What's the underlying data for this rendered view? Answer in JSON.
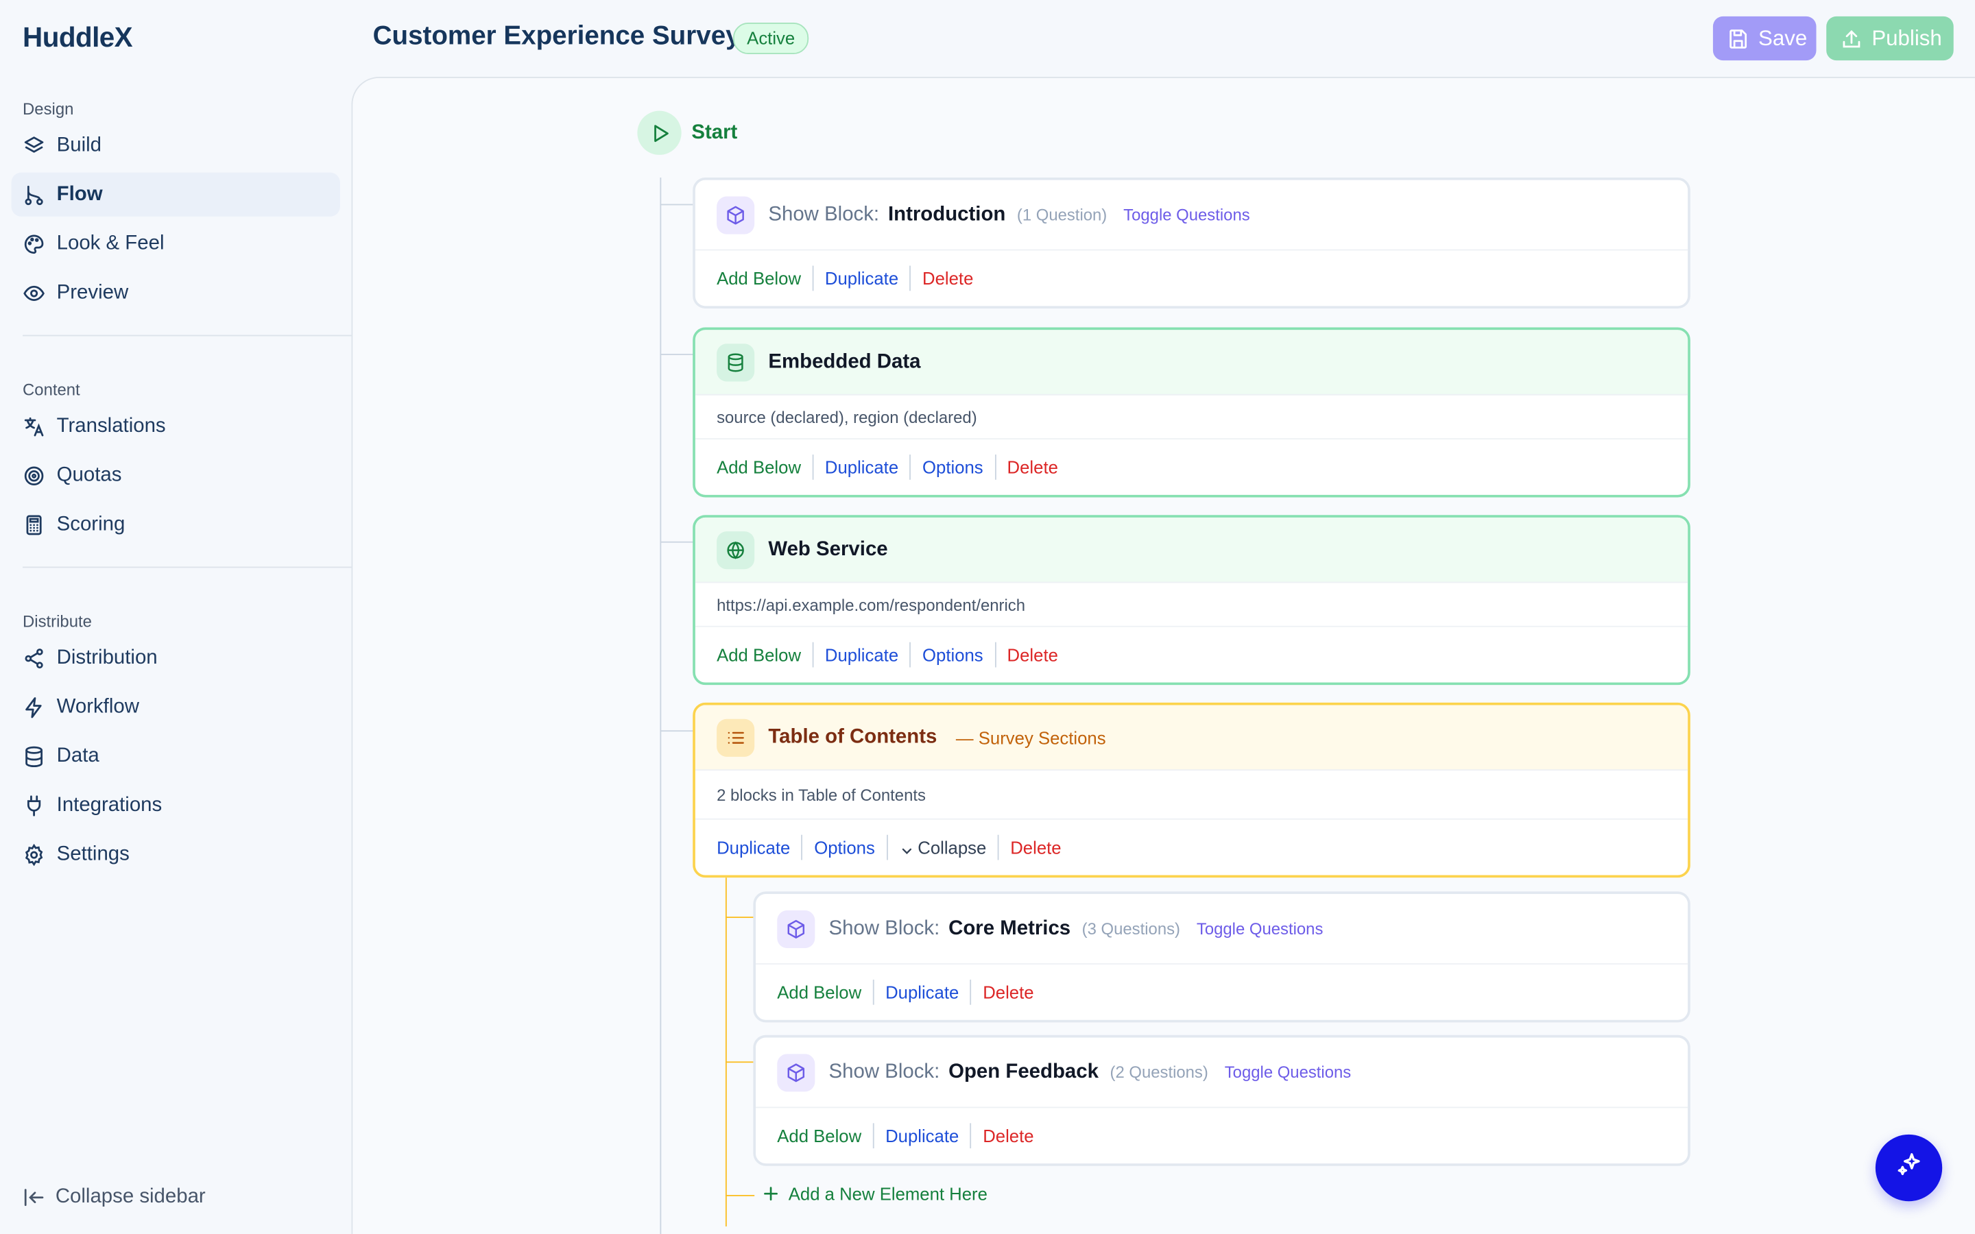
{
  "app": {
    "logo": "HuddleX"
  },
  "header": {
    "title": "Customer Experience Survey",
    "status": "Active",
    "save_label": "Save",
    "publish_label": "Publish"
  },
  "sidebar": {
    "sections": [
      {
        "heading": "Design",
        "items": [
          {
            "label": "Build",
            "icon": "layers-icon"
          },
          {
            "label": "Flow",
            "icon": "flow-icon",
            "active": true
          },
          {
            "label": "Look & Feel",
            "icon": "palette-icon"
          },
          {
            "label": "Preview",
            "icon": "eye-icon"
          }
        ]
      },
      {
        "heading": "Content",
        "items": [
          {
            "label": "Translations",
            "icon": "translate-icon"
          },
          {
            "label": "Quotas",
            "icon": "target-icon"
          },
          {
            "label": "Scoring",
            "icon": "calculator-icon"
          }
        ]
      },
      {
        "heading": "Distribute",
        "items": [
          {
            "label": "Distribution",
            "icon": "share-icon"
          },
          {
            "label": "Workflow",
            "icon": "lightning-icon"
          },
          {
            "label": "Data",
            "icon": "database-icon"
          },
          {
            "label": "Integrations",
            "icon": "plug-icon"
          },
          {
            "label": "Settings",
            "icon": "gear-icon"
          }
        ]
      }
    ],
    "collapse_label": "Collapse sidebar"
  },
  "flow": {
    "start_label": "Start",
    "blocks": [
      {
        "prefix": "Show Block:",
        "name": "Introduction",
        "count": "(1 Question)",
        "toggle": "Toggle Questions",
        "actions": [
          "Add Below",
          "Duplicate",
          "Delete"
        ]
      },
      {
        "name": "Embedded Data",
        "body": "source (declared), region (declared)",
        "actions": [
          "Add Below",
          "Duplicate",
          "Options",
          "Delete"
        ]
      },
      {
        "name": "Web Service",
        "body": "https://api.example.com/respondent/enrich",
        "actions": [
          "Add Below",
          "Duplicate",
          "Options",
          "Delete"
        ]
      },
      {
        "name": "Table of Contents",
        "subtitle": "— Survey Sections",
        "body": "2 blocks in Table of Contents",
        "actions": [
          "Duplicate",
          "Options",
          "Collapse",
          "Delete"
        ]
      },
      {
        "prefix": "Show Block:",
        "name": "Core Metrics",
        "count": "(3 Questions)",
        "toggle": "Toggle Questions",
        "actions": [
          "Add Below",
          "Duplicate",
          "Delete"
        ]
      },
      {
        "prefix": "Show Block:",
        "name": "Open Feedback",
        "count": "(2 Questions)",
        "toggle": "Toggle Questions",
        "actions": [
          "Add Below",
          "Duplicate",
          "Delete"
        ]
      }
    ],
    "add_new_label": "Add a New Element Here"
  },
  "colors": {
    "accent": "#6d5ce8",
    "green": "#15803d",
    "danger": "#dc2626",
    "link": "#1d4ed8",
    "fab": "#1414e6"
  }
}
